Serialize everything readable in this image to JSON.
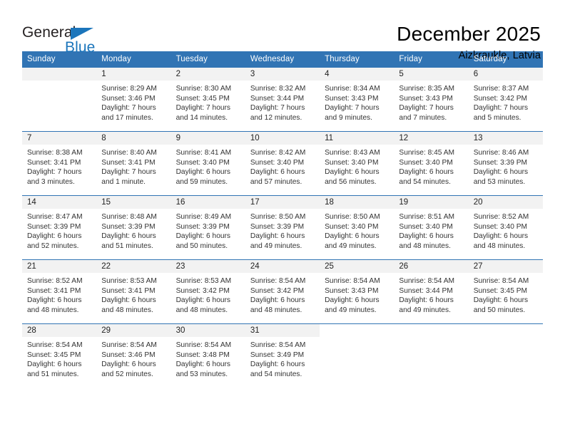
{
  "brand": {
    "word1": "General",
    "word2": "Blue",
    "triangle_color": "#1b75bb",
    "text_color": "#231f20"
  },
  "header": {
    "title": "December 2025",
    "location": "Aizkraukle, Latvia",
    "header_bg": "#3174b4",
    "daynum_bg": "#f2f2f2"
  },
  "weekday_headers": [
    "Sunday",
    "Monday",
    "Tuesday",
    "Wednesday",
    "Thursday",
    "Friday",
    "Saturday"
  ],
  "weeks": [
    [
      {
        "day": "",
        "blank": true
      },
      {
        "day": "1",
        "sunrise": "Sunrise: 8:29 AM",
        "sunset": "Sunset: 3:46 PM",
        "daylight1": "Daylight: 7 hours",
        "daylight2": "and 17 minutes."
      },
      {
        "day": "2",
        "sunrise": "Sunrise: 8:30 AM",
        "sunset": "Sunset: 3:45 PM",
        "daylight1": "Daylight: 7 hours",
        "daylight2": "and 14 minutes."
      },
      {
        "day": "3",
        "sunrise": "Sunrise: 8:32 AM",
        "sunset": "Sunset: 3:44 PM",
        "daylight1": "Daylight: 7 hours",
        "daylight2": "and 12 minutes."
      },
      {
        "day": "4",
        "sunrise": "Sunrise: 8:34 AM",
        "sunset": "Sunset: 3:43 PM",
        "daylight1": "Daylight: 7 hours",
        "daylight2": "and 9 minutes."
      },
      {
        "day": "5",
        "sunrise": "Sunrise: 8:35 AM",
        "sunset": "Sunset: 3:43 PM",
        "daylight1": "Daylight: 7 hours",
        "daylight2": "and 7 minutes."
      },
      {
        "day": "6",
        "sunrise": "Sunrise: 8:37 AM",
        "sunset": "Sunset: 3:42 PM",
        "daylight1": "Daylight: 7 hours",
        "daylight2": "and 5 minutes."
      }
    ],
    [
      {
        "day": "7",
        "sunrise": "Sunrise: 8:38 AM",
        "sunset": "Sunset: 3:41 PM",
        "daylight1": "Daylight: 7 hours",
        "daylight2": "and 3 minutes."
      },
      {
        "day": "8",
        "sunrise": "Sunrise: 8:40 AM",
        "sunset": "Sunset: 3:41 PM",
        "daylight1": "Daylight: 7 hours",
        "daylight2": "and 1 minute."
      },
      {
        "day": "9",
        "sunrise": "Sunrise: 8:41 AM",
        "sunset": "Sunset: 3:40 PM",
        "daylight1": "Daylight: 6 hours",
        "daylight2": "and 59 minutes."
      },
      {
        "day": "10",
        "sunrise": "Sunrise: 8:42 AM",
        "sunset": "Sunset: 3:40 PM",
        "daylight1": "Daylight: 6 hours",
        "daylight2": "and 57 minutes."
      },
      {
        "day": "11",
        "sunrise": "Sunrise: 8:43 AM",
        "sunset": "Sunset: 3:40 PM",
        "daylight1": "Daylight: 6 hours",
        "daylight2": "and 56 minutes."
      },
      {
        "day": "12",
        "sunrise": "Sunrise: 8:45 AM",
        "sunset": "Sunset: 3:40 PM",
        "daylight1": "Daylight: 6 hours",
        "daylight2": "and 54 minutes."
      },
      {
        "day": "13",
        "sunrise": "Sunrise: 8:46 AM",
        "sunset": "Sunset: 3:39 PM",
        "daylight1": "Daylight: 6 hours",
        "daylight2": "and 53 minutes."
      }
    ],
    [
      {
        "day": "14",
        "sunrise": "Sunrise: 8:47 AM",
        "sunset": "Sunset: 3:39 PM",
        "daylight1": "Daylight: 6 hours",
        "daylight2": "and 52 minutes."
      },
      {
        "day": "15",
        "sunrise": "Sunrise: 8:48 AM",
        "sunset": "Sunset: 3:39 PM",
        "daylight1": "Daylight: 6 hours",
        "daylight2": "and 51 minutes."
      },
      {
        "day": "16",
        "sunrise": "Sunrise: 8:49 AM",
        "sunset": "Sunset: 3:39 PM",
        "daylight1": "Daylight: 6 hours",
        "daylight2": "and 50 minutes."
      },
      {
        "day": "17",
        "sunrise": "Sunrise: 8:50 AM",
        "sunset": "Sunset: 3:39 PM",
        "daylight1": "Daylight: 6 hours",
        "daylight2": "and 49 minutes."
      },
      {
        "day": "18",
        "sunrise": "Sunrise: 8:50 AM",
        "sunset": "Sunset: 3:40 PM",
        "daylight1": "Daylight: 6 hours",
        "daylight2": "and 49 minutes."
      },
      {
        "day": "19",
        "sunrise": "Sunrise: 8:51 AM",
        "sunset": "Sunset: 3:40 PM",
        "daylight1": "Daylight: 6 hours",
        "daylight2": "and 48 minutes."
      },
      {
        "day": "20",
        "sunrise": "Sunrise: 8:52 AM",
        "sunset": "Sunset: 3:40 PM",
        "daylight1": "Daylight: 6 hours",
        "daylight2": "and 48 minutes."
      }
    ],
    [
      {
        "day": "21",
        "sunrise": "Sunrise: 8:52 AM",
        "sunset": "Sunset: 3:41 PM",
        "daylight1": "Daylight: 6 hours",
        "daylight2": "and 48 minutes."
      },
      {
        "day": "22",
        "sunrise": "Sunrise: 8:53 AM",
        "sunset": "Sunset: 3:41 PM",
        "daylight1": "Daylight: 6 hours",
        "daylight2": "and 48 minutes."
      },
      {
        "day": "23",
        "sunrise": "Sunrise: 8:53 AM",
        "sunset": "Sunset: 3:42 PM",
        "daylight1": "Daylight: 6 hours",
        "daylight2": "and 48 minutes."
      },
      {
        "day": "24",
        "sunrise": "Sunrise: 8:54 AM",
        "sunset": "Sunset: 3:42 PM",
        "daylight1": "Daylight: 6 hours",
        "daylight2": "and 48 minutes."
      },
      {
        "day": "25",
        "sunrise": "Sunrise: 8:54 AM",
        "sunset": "Sunset: 3:43 PM",
        "daylight1": "Daylight: 6 hours",
        "daylight2": "and 49 minutes."
      },
      {
        "day": "26",
        "sunrise": "Sunrise: 8:54 AM",
        "sunset": "Sunset: 3:44 PM",
        "daylight1": "Daylight: 6 hours",
        "daylight2": "and 49 minutes."
      },
      {
        "day": "27",
        "sunrise": "Sunrise: 8:54 AM",
        "sunset": "Sunset: 3:45 PM",
        "daylight1": "Daylight: 6 hours",
        "daylight2": "and 50 minutes."
      }
    ],
    [
      {
        "day": "28",
        "sunrise": "Sunrise: 8:54 AM",
        "sunset": "Sunset: 3:45 PM",
        "daylight1": "Daylight: 6 hours",
        "daylight2": "and 51 minutes."
      },
      {
        "day": "29",
        "sunrise": "Sunrise: 8:54 AM",
        "sunset": "Sunset: 3:46 PM",
        "daylight1": "Daylight: 6 hours",
        "daylight2": "and 52 minutes."
      },
      {
        "day": "30",
        "sunrise": "Sunrise: 8:54 AM",
        "sunset": "Sunset: 3:48 PM",
        "daylight1": "Daylight: 6 hours",
        "daylight2": "and 53 minutes."
      },
      {
        "day": "31",
        "sunrise": "Sunrise: 8:54 AM",
        "sunset": "Sunset: 3:49 PM",
        "daylight1": "Daylight: 6 hours",
        "daylight2": "and 54 minutes."
      },
      {
        "day": "",
        "void": true
      },
      {
        "day": "",
        "void": true
      },
      {
        "day": "",
        "void": true
      }
    ]
  ]
}
